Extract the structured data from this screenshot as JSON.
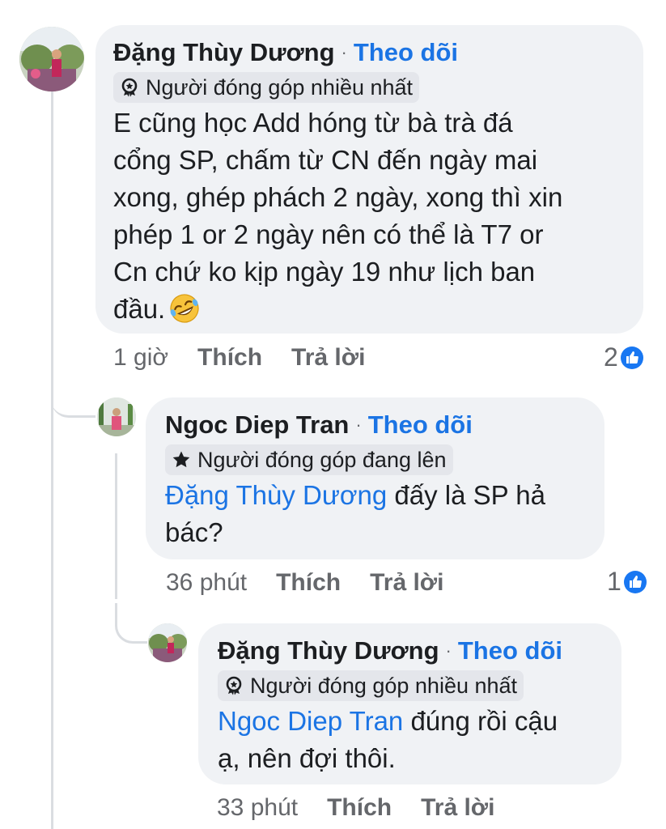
{
  "comments": [
    {
      "author": "Đặng Thùy Dương",
      "separator": "·",
      "follow": "Theo dõi",
      "badge": "Người đóng góp nhiều nhất",
      "text_lines": [
        "E cũng học Add hóng từ bà trà đá",
        "cổng SP, chấm từ CN đến ngày mai",
        "xong, ghép phách 2 ngày, xong thì xin",
        "phép 1 or 2 ngày nên có thể là T7 or",
        "Cn chứ ko kịp ngày 19 như lịch ban",
        "đầu."
      ],
      "emoji": "rolling-on-floor-laughing-emoji",
      "time": "1 giờ",
      "like_label": "Thích",
      "reply_label": "Trả lời",
      "reaction_count": "2"
    },
    {
      "author": "Ngoc Diep Tran",
      "separator": "·",
      "follow": "Theo dõi",
      "badge": "Người đóng góp đang lên",
      "mention": "Đặng Thùy Dương",
      "text_after_mention": " đấy là SP hả",
      "text_line2": "bác?",
      "time": "36 phút",
      "like_label": "Thích",
      "reply_label": "Trả lời",
      "reaction_count": "1"
    },
    {
      "author": "Đặng Thùy Dương",
      "separator": "·",
      "follow": "Theo dõi",
      "badge": "Người đóng góp nhiều nhất",
      "mention": "Ngoc Diep Tran",
      "text_after_mention": " đúng rồi cậu",
      "text_line2": "ạ, nên đợi thôi.",
      "time": "33 phút",
      "like_label": "Thích",
      "reply_label": "Trả lời"
    }
  ],
  "colors": {
    "link": "#1b74e4",
    "bubble": "#f0f2f5",
    "badge_bg": "#e4e6eb",
    "meta_text": "#65676b",
    "like_blue": "#1877f2"
  }
}
